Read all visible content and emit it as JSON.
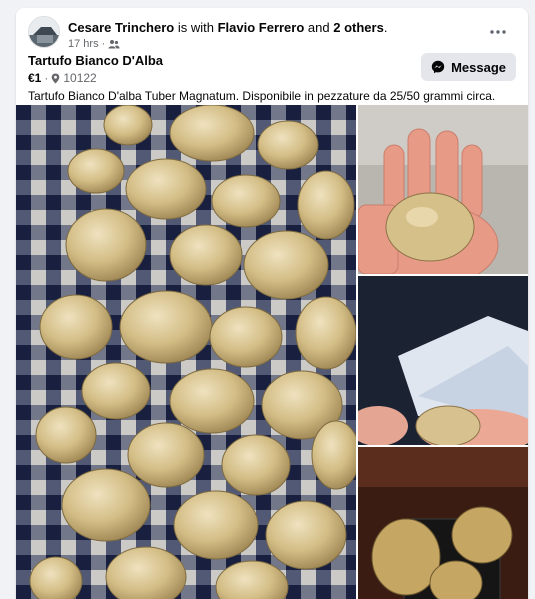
{
  "post": {
    "author": "Cesare Trinchero",
    "is_with": "is with",
    "tagged": "Flavio Ferrero",
    "and": "and",
    "others": "2 others",
    "suffix": ".",
    "time": "17 hrs",
    "dot": "·",
    "audience_icon": "friends-icon",
    "more_icon": "more-options-icon"
  },
  "listing": {
    "title": "Tartufo Bianco D'Alba",
    "price": "€1",
    "sep": "·",
    "location": "10122",
    "location_icon": "location-pin-icon",
    "message_label": "Message",
    "message_icon": "messenger-icon",
    "description": "Tartufo Bianco D'alba Tuber Magnatum. Disponibile in pezzature da 25/50 grammi circa."
  },
  "photos": [
    {
      "name": "truffles-in-basket"
    },
    {
      "name": "truffle-in-hand"
    },
    {
      "name": "truffle-held-dark"
    },
    {
      "name": "truffles-on-scale"
    }
  ],
  "colors": {
    "background": "#f0f2f5",
    "card": "#ffffff",
    "secondary_text": "#65676b",
    "button_bg": "#e4e6eb"
  }
}
